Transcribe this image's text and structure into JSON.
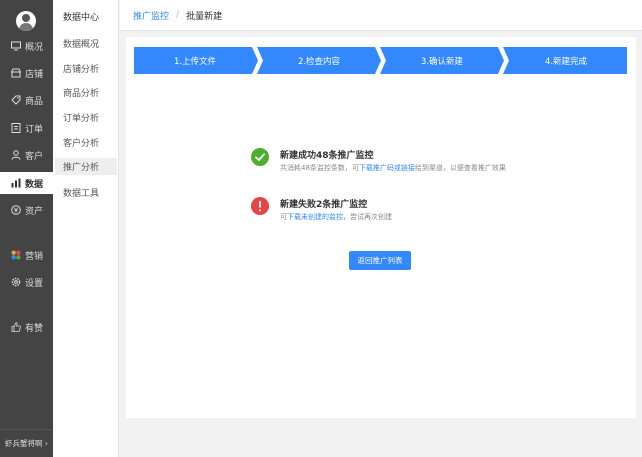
{
  "rail": {
    "items": [
      {
        "label": "概况",
        "icon": "monitor-icon"
      },
      {
        "label": "店铺",
        "icon": "shop-icon"
      },
      {
        "label": "商品",
        "icon": "tag-icon"
      },
      {
        "label": "订单",
        "icon": "order-icon"
      },
      {
        "label": "客户",
        "icon": "user-icon"
      },
      {
        "label": "数据",
        "icon": "bar-chart-icon"
      },
      {
        "label": "资产",
        "icon": "yen-icon"
      },
      {
        "label": "营销",
        "icon": "apps-icon"
      },
      {
        "label": "设置",
        "icon": "gear-icon"
      },
      {
        "label": "有赞",
        "icon": "thumb-icon"
      }
    ],
    "footer": "虾兵蟹将啊 ›"
  },
  "submenu": {
    "title": "数据中心",
    "items": [
      "数据概况",
      "店铺分析",
      "商品分析",
      "订单分析",
      "客户分析",
      "推广分析",
      "数据工具"
    ]
  },
  "breadcrumb": {
    "link": "推广监控",
    "separator": "/",
    "current": "批量新建"
  },
  "steps": [
    "1.上传文件",
    "2.检查内容",
    "3.确认新建",
    "4.新建完成"
  ],
  "success": {
    "heading": "新建成功48条推广监控",
    "desc_before": "共消耗48条监控条数，可",
    "desc_link": "下载推广码或链接",
    "desc_after": "给到渠道，以便查看推广效果"
  },
  "failure": {
    "heading": "新建失败2条推广监控",
    "desc_before": "可",
    "desc_link": "下载未创建的监控",
    "desc_after": "，尝试再次创建"
  },
  "back_button": "返回推广列表",
  "colors": {
    "primary": "#3388ff",
    "success": "#4caf2f",
    "error": "#e94444",
    "rail": "#444444"
  }
}
